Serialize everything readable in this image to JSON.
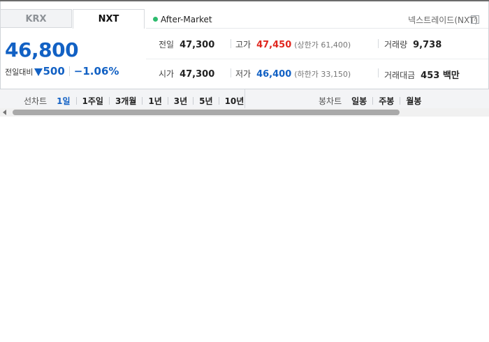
{
  "tabs": [
    {
      "label": "KRX",
      "active": false
    },
    {
      "label": "NXT",
      "active": true
    }
  ],
  "session": {
    "label": "After-Market",
    "indicator_color": "#2dbb6e"
  },
  "exchange_info": {
    "label": "넥스트레이드(NXT)",
    "help": "?"
  },
  "quote": {
    "price": "46,800",
    "change_label": "전일대비",
    "change_amount": "500",
    "change_direction": "down",
    "change_percent": "−1.06%",
    "color_down": "#1261c4",
    "color_up": "#e0261e"
  },
  "stats": {
    "prev_close": {
      "label": "전일",
      "value": "47,300"
    },
    "high": {
      "label": "고가",
      "value": "47,450",
      "limit_label": "(상한가 61,400)"
    },
    "volume": {
      "label": "거래량",
      "value": "9,738"
    },
    "open": {
      "label": "시가",
      "value": "47,300"
    },
    "low": {
      "label": "저가",
      "value": "46,400",
      "limit_label": "(하한가 33,150)"
    },
    "trade_value": {
      "label": "거래대금",
      "value": "453 백만"
    }
  },
  "line_chart": {
    "label": "선차트",
    "periods": [
      "1일",
      "1주일",
      "3개월",
      "1년",
      "3년",
      "5년",
      "10년"
    ],
    "active_period": "1일"
  },
  "candle_chart": {
    "label": "봉차트",
    "periods": [
      "일봉",
      "주봉",
      "월봉"
    ]
  }
}
